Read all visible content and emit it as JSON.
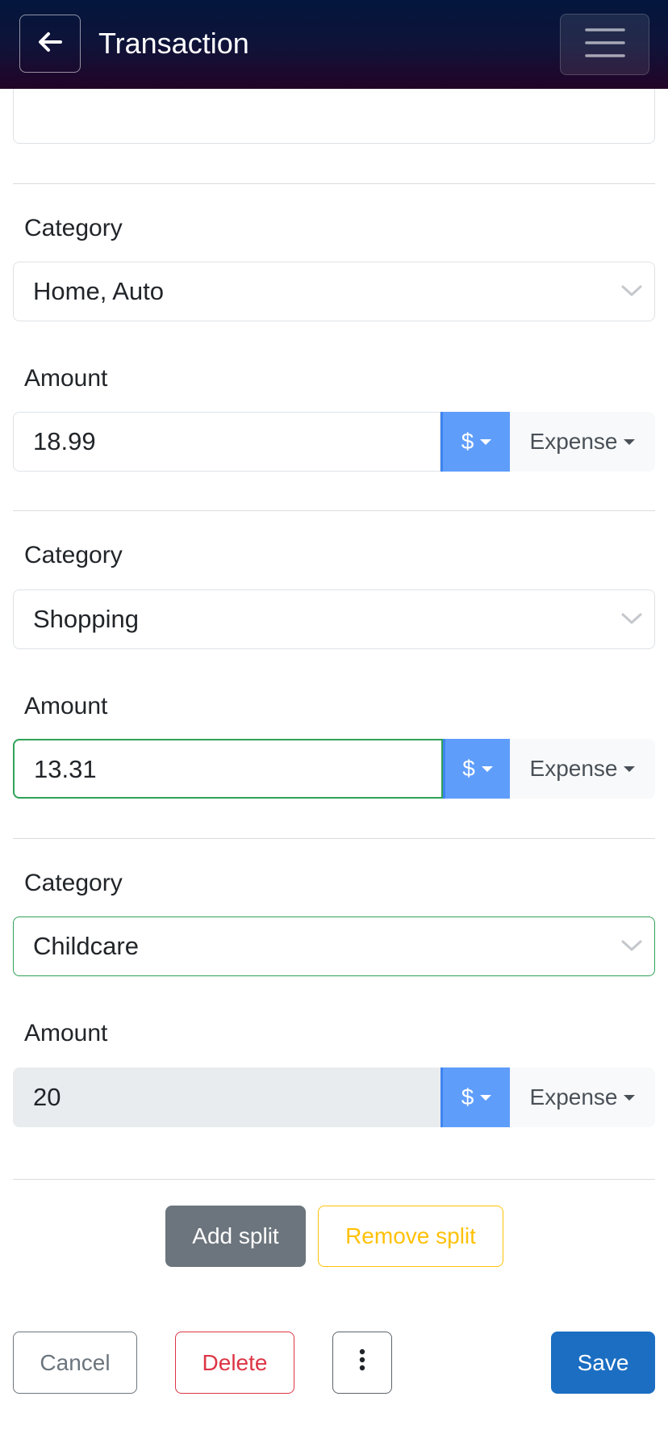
{
  "header": {
    "title": "Transaction",
    "back_icon": "arrow-left-icon",
    "menu_icon": "hamburger-menu-icon"
  },
  "splits": [
    {
      "category_label": "Category",
      "category_value": "Home, Auto",
      "amount_label": "Amount",
      "amount_value": "18.99",
      "currency": "$",
      "type": "Expense"
    },
    {
      "category_label": "Category",
      "category_value": "Shopping",
      "amount_label": "Amount",
      "amount_value": "13.31",
      "currency": "$",
      "type": "Expense"
    },
    {
      "category_label": "Category",
      "category_value": "Childcare",
      "amount_label": "Amount",
      "amount_value": "20",
      "currency": "$",
      "type": "Expense"
    }
  ],
  "actions": {
    "add_split": "Add split",
    "remove_split": "Remove split",
    "cancel": "Cancel",
    "delete": "Delete",
    "save": "Save",
    "more_icon": "vertical-dots-icon"
  },
  "colors": {
    "primary": "#1b6ec2",
    "currency_button": "#5f9dfb",
    "valid": "#2fa256",
    "danger": "#dc3545",
    "warning": "#ffc107",
    "secondary": "#6c757d"
  }
}
